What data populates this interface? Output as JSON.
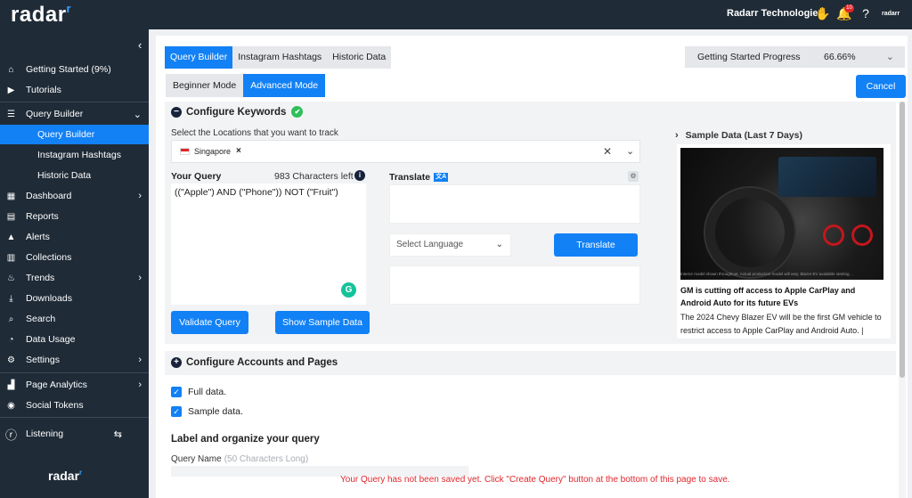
{
  "brand": {
    "name": "radar",
    "accent": "#1281f5"
  },
  "header": {
    "company": "Radarr Technologies",
    "notification_count": "10",
    "small_logo": "radarr"
  },
  "sidebar": {
    "items": [
      {
        "label": "Getting Started (9%)",
        "icon": "home-icon"
      },
      {
        "label": "Tutorials",
        "icon": "video-icon"
      },
      {
        "label": "Query Builder",
        "icon": "list-icon",
        "expanded": true,
        "children": [
          {
            "label": "Query Builder",
            "active": true
          },
          {
            "label": "Instagram Hashtags"
          },
          {
            "label": "Historic Data"
          }
        ]
      },
      {
        "label": "Dashboard",
        "icon": "grid-icon"
      },
      {
        "label": "Reports",
        "icon": "report-icon"
      },
      {
        "label": "Alerts",
        "icon": "alert-icon"
      },
      {
        "label": "Collections",
        "icon": "collections-icon"
      },
      {
        "label": "Trends",
        "icon": "flame-icon"
      },
      {
        "label": "Downloads",
        "icon": "download-icon"
      },
      {
        "label": "Search",
        "icon": "search-icon"
      },
      {
        "label": "Data Usage",
        "icon": "gauge-icon"
      },
      {
        "label": "Settings",
        "icon": "gear-icon"
      },
      {
        "label": "Page Analytics",
        "icon": "analytics-icon"
      },
      {
        "label": "Social Tokens",
        "icon": "token-icon"
      },
      {
        "label": "Listening",
        "icon": "listening-icon"
      }
    ],
    "footer_logo": "radar"
  },
  "main": {
    "tabs": [
      "Query Builder",
      "Instagram Hashtags",
      "Historic Data"
    ],
    "active_tab": "Query Builder",
    "mode_tabs": [
      "Beginner Mode",
      "Advanced Mode"
    ],
    "active_mode": "Advanced Mode",
    "progress": {
      "label": "Getting Started Progress",
      "value": "66.66%",
      "fraction": 0.6666
    },
    "cancel_label": "Cancel",
    "keywords": {
      "title": "Configure Keywords",
      "location_label": "Select the Locations that you want to track",
      "location_chip": "Singapore",
      "query_label": "Your Query",
      "chars_left": "983 Characters left",
      "query_text": "((\"Apple\") AND (\"Phone\")) NOT  (\"Fruit\")",
      "validate_label": "Validate Query",
      "sample_label": "Show Sample Data",
      "translate_label": "Translate",
      "language_placeholder": "Select Language",
      "translate_button": "Translate"
    },
    "sample_data": {
      "title": "Sample Data (Last 7 Days)",
      "image_caption": "Interior model shown throughout. Actual production model will vary. Blazer EV available starting…",
      "headline": "GM is cutting off access to Apple CarPlay and Android Auto for its future EVs",
      "description": "The 2024 Chevy Blazer EV will be the first GM vehicle to restrict access to Apple CarPlay and Android Auto. | Image:"
    },
    "accounts": {
      "title": "Configure Accounts and Pages",
      "full_data": "Full data.",
      "sample_data": "Sample data.",
      "label_org": "Label and organize your query",
      "query_name_label": "Query Name",
      "query_name_hint": "(50 Characters Long)"
    },
    "warning": "Your Query has not been saved yet. Click \"Create Query\" button at the bottom of this page to save."
  }
}
